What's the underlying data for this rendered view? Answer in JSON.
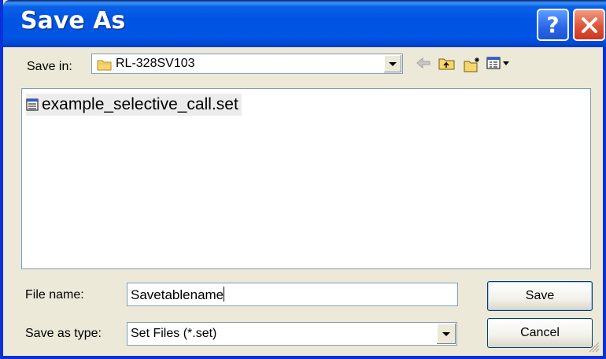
{
  "window": {
    "title": "Save As",
    "help_glyph": "?",
    "close_glyph": "close-icon"
  },
  "save_in": {
    "label": "Save in:",
    "current_folder": "RL-328SV103",
    "folder_icon": "folder-icon"
  },
  "toolbar": {
    "icons": [
      "back-arrow-icon",
      "up-folder-icon",
      "new-folder-icon",
      "view-menu-icon"
    ]
  },
  "file_list": {
    "items": [
      {
        "name": "example_selective_call.set",
        "icon": "set-file-icon"
      }
    ]
  },
  "file_name": {
    "label": "File name:",
    "value": "Savetablename"
  },
  "save_as_type": {
    "label": "Save as type:",
    "value": "Set Files (*.set)"
  },
  "buttons": {
    "save": "Save",
    "cancel": "Cancel"
  },
  "colors": {
    "titlebar": "#0054E3",
    "dialog_bg": "#ECE9D8",
    "close_button": "#E0533B"
  }
}
